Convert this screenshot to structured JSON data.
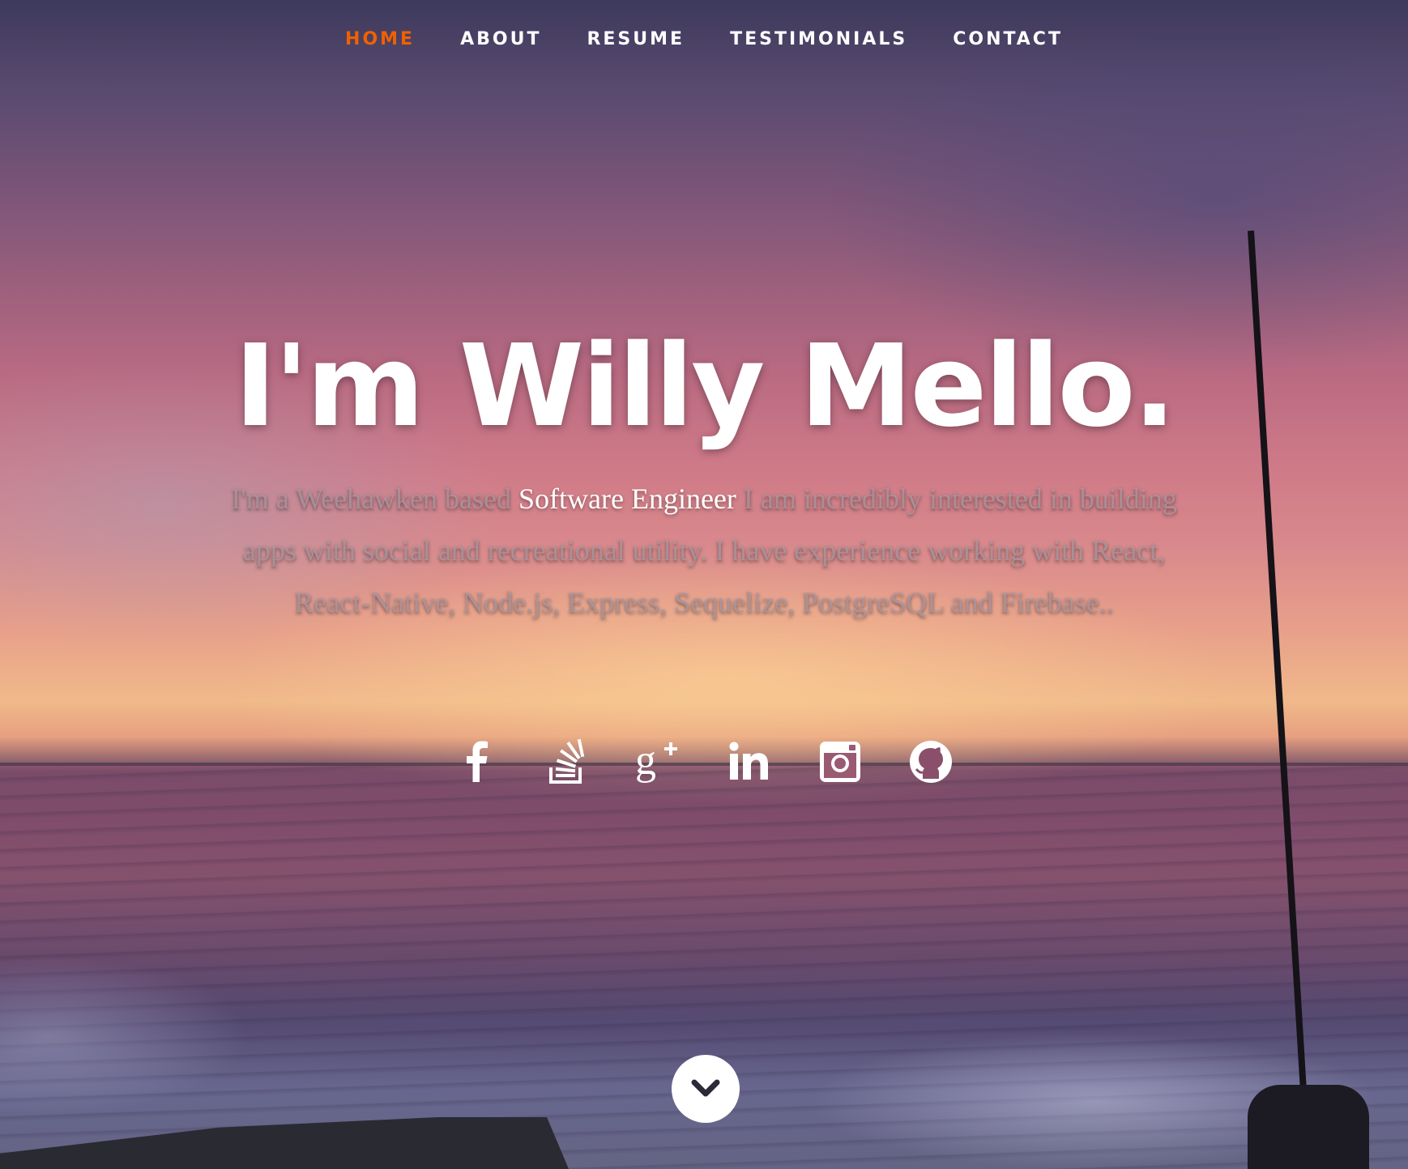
{
  "nav": {
    "items": [
      {
        "label": "HOME",
        "active": true
      },
      {
        "label": "ABOUT",
        "active": false
      },
      {
        "label": "RESUME",
        "active": false
      },
      {
        "label": "TESTIMONIALS",
        "active": false
      },
      {
        "label": "CONTACT",
        "active": false
      }
    ],
    "active_color": "#f06000"
  },
  "banner": {
    "title": "I'm Willy Mello.",
    "intro_before": "I'm a Weehawken based ",
    "intro_highlight": "Software Engineer",
    "intro_after": " I am incredibly interested in building apps with social and recreational utility. I have experience working with React, React-Native, Node.js, Express, Sequelize, PostgreSQL and Firebase.."
  },
  "social": {
    "icons": [
      "facebook-icon",
      "stackoverflow-icon",
      "google-plus-icon",
      "linkedin-icon",
      "instagram-icon",
      "github-icon"
    ]
  },
  "scroll_down": {
    "icon": "chevron-down-icon"
  }
}
